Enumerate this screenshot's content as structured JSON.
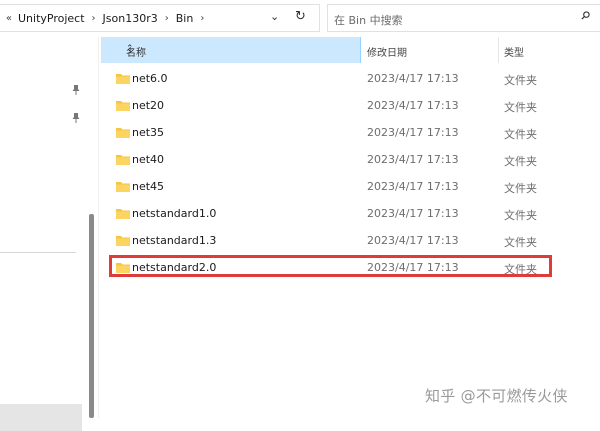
{
  "address_bar": {
    "overflow": "«",
    "breadcrumbs": [
      "UnityProject",
      "Json130r3",
      "Bin"
    ],
    "separator": "›"
  },
  "search": {
    "placeholder": "在 Bin 中搜索"
  },
  "columns": {
    "name": "名称",
    "date_modified": "修改日期",
    "type": "类型"
  },
  "files": [
    {
      "name": "net6.0",
      "date": "2023/4/17 17:13",
      "type": "文件夹"
    },
    {
      "name": "net20",
      "date": "2023/4/17 17:13",
      "type": "文件夹"
    },
    {
      "name": "net35",
      "date": "2023/4/17 17:13",
      "type": "文件夹"
    },
    {
      "name": "net40",
      "date": "2023/4/17 17:13",
      "type": "文件夹"
    },
    {
      "name": "net45",
      "date": "2023/4/17 17:13",
      "type": "文件夹"
    },
    {
      "name": "netstandard1.0",
      "date": "2023/4/17 17:13",
      "type": "文件夹"
    },
    {
      "name": "netstandard1.3",
      "date": "2023/4/17 17:13",
      "type": "文件夹"
    },
    {
      "name": "netstandard2.0",
      "date": "2023/4/17 17:13",
      "type": "文件夹"
    }
  ],
  "watermark": "知乎 @不可燃传火侠",
  "colors": {
    "header_selected": "#cce8ff",
    "highlight_border": "#e03b3b",
    "folder": "#f8c443"
  }
}
